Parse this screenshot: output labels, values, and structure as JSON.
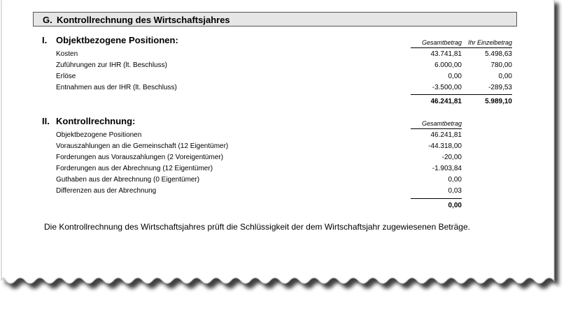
{
  "section": {
    "letter": "G.",
    "title": "Kontrollrechnung des Wirtschaftsjahres"
  },
  "part1": {
    "number": "I.",
    "title": "Objektbezogene Positionen:",
    "col_total_label": "Gesamtbetrag",
    "col_single_label": "Ihr Einzelbetrag",
    "rows": [
      {
        "label": "Kosten",
        "total": "43.741,81",
        "single": "5.498,63"
      },
      {
        "label": "Zuführungen zur IHR (lt. Beschluss)",
        "total": "6.000,00",
        "single": "780,00"
      },
      {
        "label": "Erlöse",
        "total": "0,00",
        "single": "0,00"
      },
      {
        "label": "Entnahmen aus der IHR (lt. Beschluss)",
        "total": "-3.500,00",
        "single": "-289,53"
      }
    ],
    "sum_total": "46.241,81",
    "sum_single": "5.989,10"
  },
  "part2": {
    "number": "II.",
    "title": "Kontrollrechnung:",
    "col_total_label": "Gesamtbetrag",
    "rows": [
      {
        "label": "Objektbezogene Positionen",
        "total": "46.241,81"
      },
      {
        "label": "Vorauszahlungen an die Gemeinschaft (12 Eigentümer)",
        "total": "-44.318,00"
      },
      {
        "label": "Forderungen aus Vorauszahlungen (2 Voreigentümer)",
        "total": "-20,00"
      },
      {
        "label": "Forderungen aus der Abrechnung (12 Eigentümer)",
        "total": "-1.903,84"
      },
      {
        "label": "Guthaben aus der Abrechnung (0 Eigentümer)",
        "total": "0,00"
      },
      {
        "label": "Differenzen aus der Abrechnung",
        "total": "0,03"
      }
    ],
    "sum_total": "0,00"
  },
  "note": "Die Kontrollrechnung des Wirtschaftsjahres prüft die Schlüssigkeit der dem Wirtschaftsjahr zugewiesenen Beträge."
}
